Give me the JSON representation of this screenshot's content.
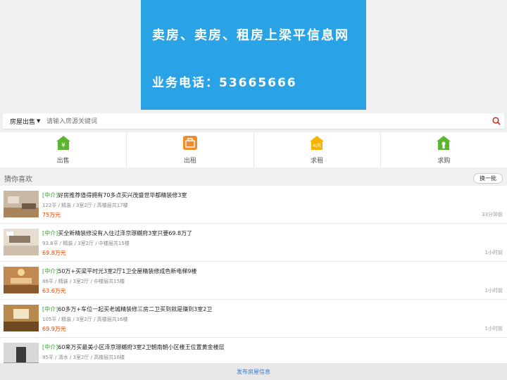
{
  "banner": {
    "line1": "卖房、卖房、租房上梁平信息网",
    "line2": "业务电话：53665666"
  },
  "search": {
    "category": "房屋出售",
    "placeholder": "请输入房源关键词"
  },
  "categories": [
    {
      "label": "出售",
      "icon": "house-yen-icon",
      "color": "#5cb531"
    },
    {
      "label": "出租",
      "icon": "briefcase-icon",
      "color": "#f08c2a"
    },
    {
      "label": "求租",
      "icon": "house-search-icon",
      "color": "#f5b400"
    },
    {
      "label": "求购",
      "icon": "house-person-icon",
      "color": "#5cb531"
    }
  ],
  "guess": {
    "title": "猜你喜欢",
    "swap": "换一批"
  },
  "listings": [
    {
      "tag": "[中介]",
      "title": "好房推荐值得拥有70多点买兴茂盛世华都精装修3室",
      "meta": "122平 / 精装 / 3室2厅 / 高楼层共17楼",
      "price": "75万元",
      "time": "33分钟前"
    },
    {
      "tag": "[中介]",
      "title": "买全新精装修没有入住过泽京璟樾府3室只要69.8万了",
      "meta": "93.8平 / 精装 / 3室2厅 / 中楼层共15楼",
      "price": "69.8万元",
      "time": "1小时前"
    },
    {
      "tag": "[中介]",
      "title": "50万+买梁平时光3室2厅1卫全屋精装修成色新电梯9楼",
      "meta": "86平 / 精装 / 3室2厅 / 中楼层共15楼",
      "price": "63.6万元",
      "time": "1小时前"
    },
    {
      "tag": "[中介]",
      "title": "60多万+车位一起买老城精装修三房二卫买到就是赚到3室2卫",
      "meta": "105平 / 精装 / 3室2厅 / 高楼层共16楼",
      "price": "69.9万元",
      "time": "1小时前"
    },
    {
      "tag": "[中介]",
      "title": "60来万买最美小区泽京璟樾府3室2卫朝南朝小区楼王位置黄金楼层",
      "meta": "95平 / 清水 / 3室2厅 / 高楼层共16楼",
      "price": "",
      "time": ""
    }
  ],
  "footer": {
    "publish": "发布房屋信息"
  }
}
